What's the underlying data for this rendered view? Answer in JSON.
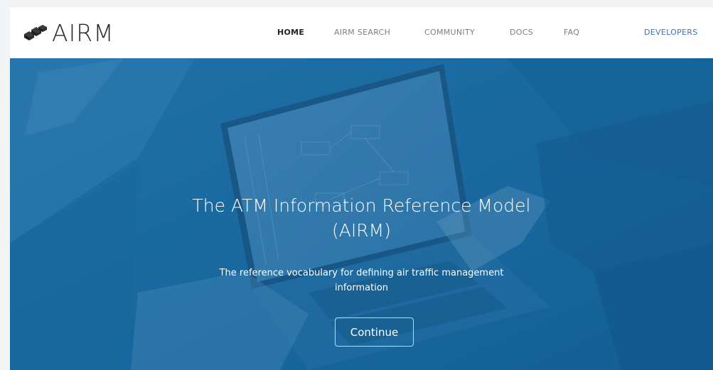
{
  "header": {
    "logo_text": "AIRM",
    "nav": [
      {
        "label": "HOME",
        "active": true
      },
      {
        "label": "AIRM SEARCH",
        "active": false
      },
      {
        "label": "COMMUNITY",
        "active": false
      },
      {
        "label": "DOCS",
        "active": false
      },
      {
        "label": "FAQ",
        "active": false
      },
      {
        "label": "DEVELOPERS",
        "active": false
      }
    ]
  },
  "hero": {
    "title_line1": "The ATM Information Reference Model",
    "title_line2": "(AIRM)",
    "subtitle_line1": "The reference vocabulary for defining air traffic management",
    "subtitle_line2": "information",
    "button_label": "Continue"
  },
  "colors": {
    "hero_tint": "#1f6a9f",
    "nav_active": "#1e2228",
    "nav_default": "#7a7f87",
    "nav_highlight": "#3f73b6"
  },
  "icons": {
    "logo": "airm-cubes-logo-icon"
  }
}
